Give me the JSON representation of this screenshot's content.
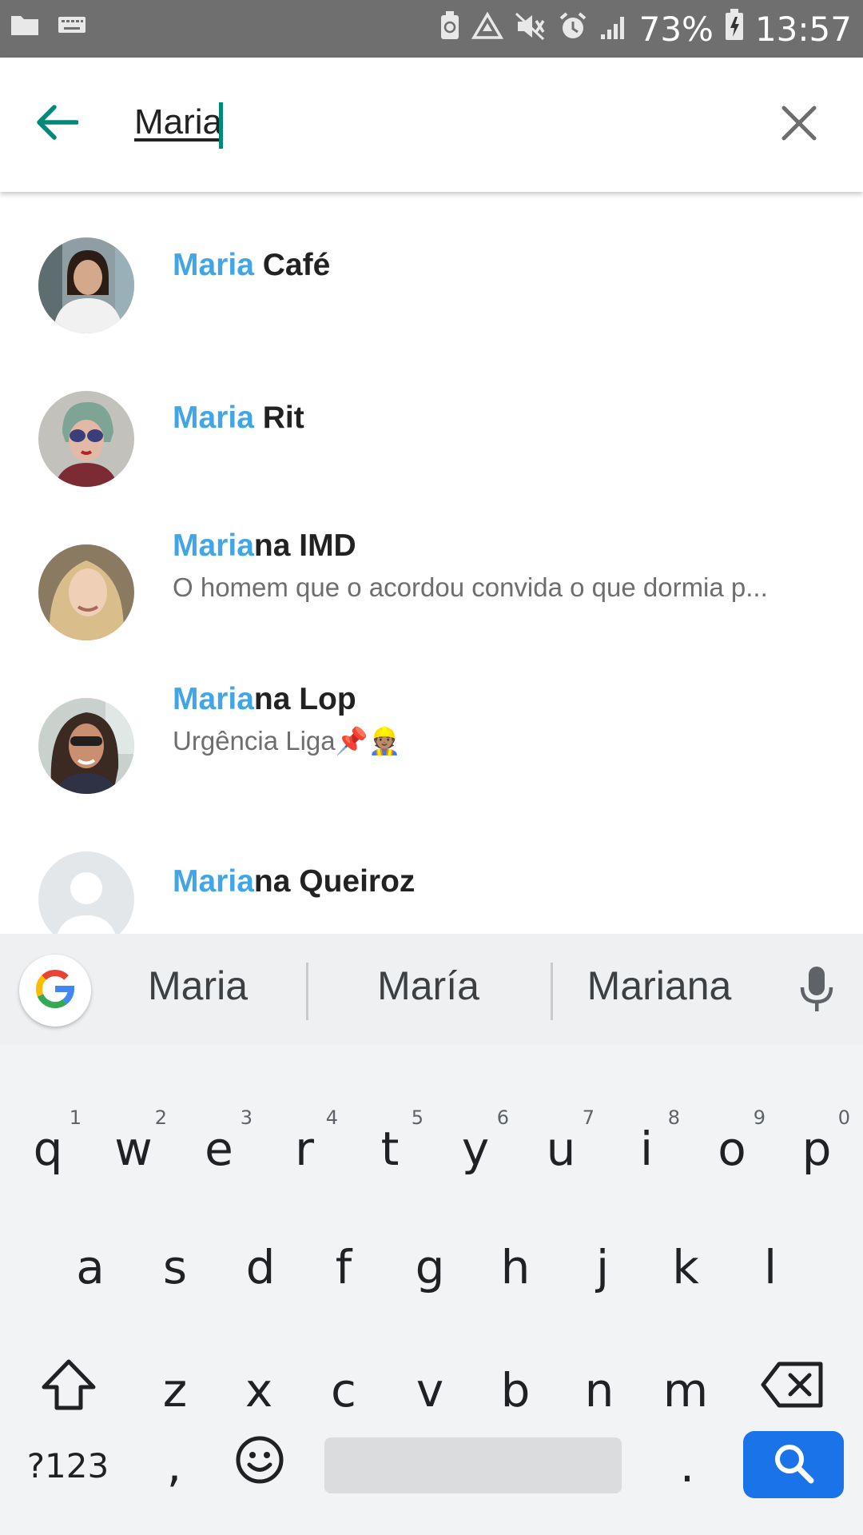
{
  "status_bar": {
    "battery_percent": "73%",
    "time": "13:57"
  },
  "search": {
    "query": "Maria",
    "accent_color": "#00897b"
  },
  "results": [
    {
      "highlight": "Maria",
      "rest": " Café",
      "status": ""
    },
    {
      "highlight": "Maria",
      "rest": " Rit",
      "status": ""
    },
    {
      "highlight": "Maria",
      "rest": "na IMD",
      "status": "O homem que o acordou convida o que dormia p..."
    },
    {
      "highlight": "Maria",
      "rest": "na Lop",
      "status": "Urgência Liga📌👷🏽"
    },
    {
      "highlight": "Maria",
      "rest": "na Queiroz",
      "status": ""
    }
  ],
  "highlight_color": "#42a5e6",
  "suggestions": [
    "Maria",
    "María",
    "Mariana"
  ],
  "keyboard": {
    "row1": [
      {
        "key": "q",
        "hint": "1"
      },
      {
        "key": "w",
        "hint": "2"
      },
      {
        "key": "e",
        "hint": "3"
      },
      {
        "key": "r",
        "hint": "4"
      },
      {
        "key": "t",
        "hint": "5"
      },
      {
        "key": "y",
        "hint": "6"
      },
      {
        "key": "u",
        "hint": "7"
      },
      {
        "key": "i",
        "hint": "8"
      },
      {
        "key": "o",
        "hint": "9"
      },
      {
        "key": "p",
        "hint": "0"
      }
    ],
    "row2": [
      "a",
      "s",
      "d",
      "f",
      "g",
      "h",
      "j",
      "k",
      "l"
    ],
    "row3": [
      "z",
      "x",
      "c",
      "v",
      "b",
      "n",
      "m"
    ],
    "symbols_label": "?123",
    "comma": ",",
    "period": ".",
    "search_key_color": "#1a73e8"
  }
}
